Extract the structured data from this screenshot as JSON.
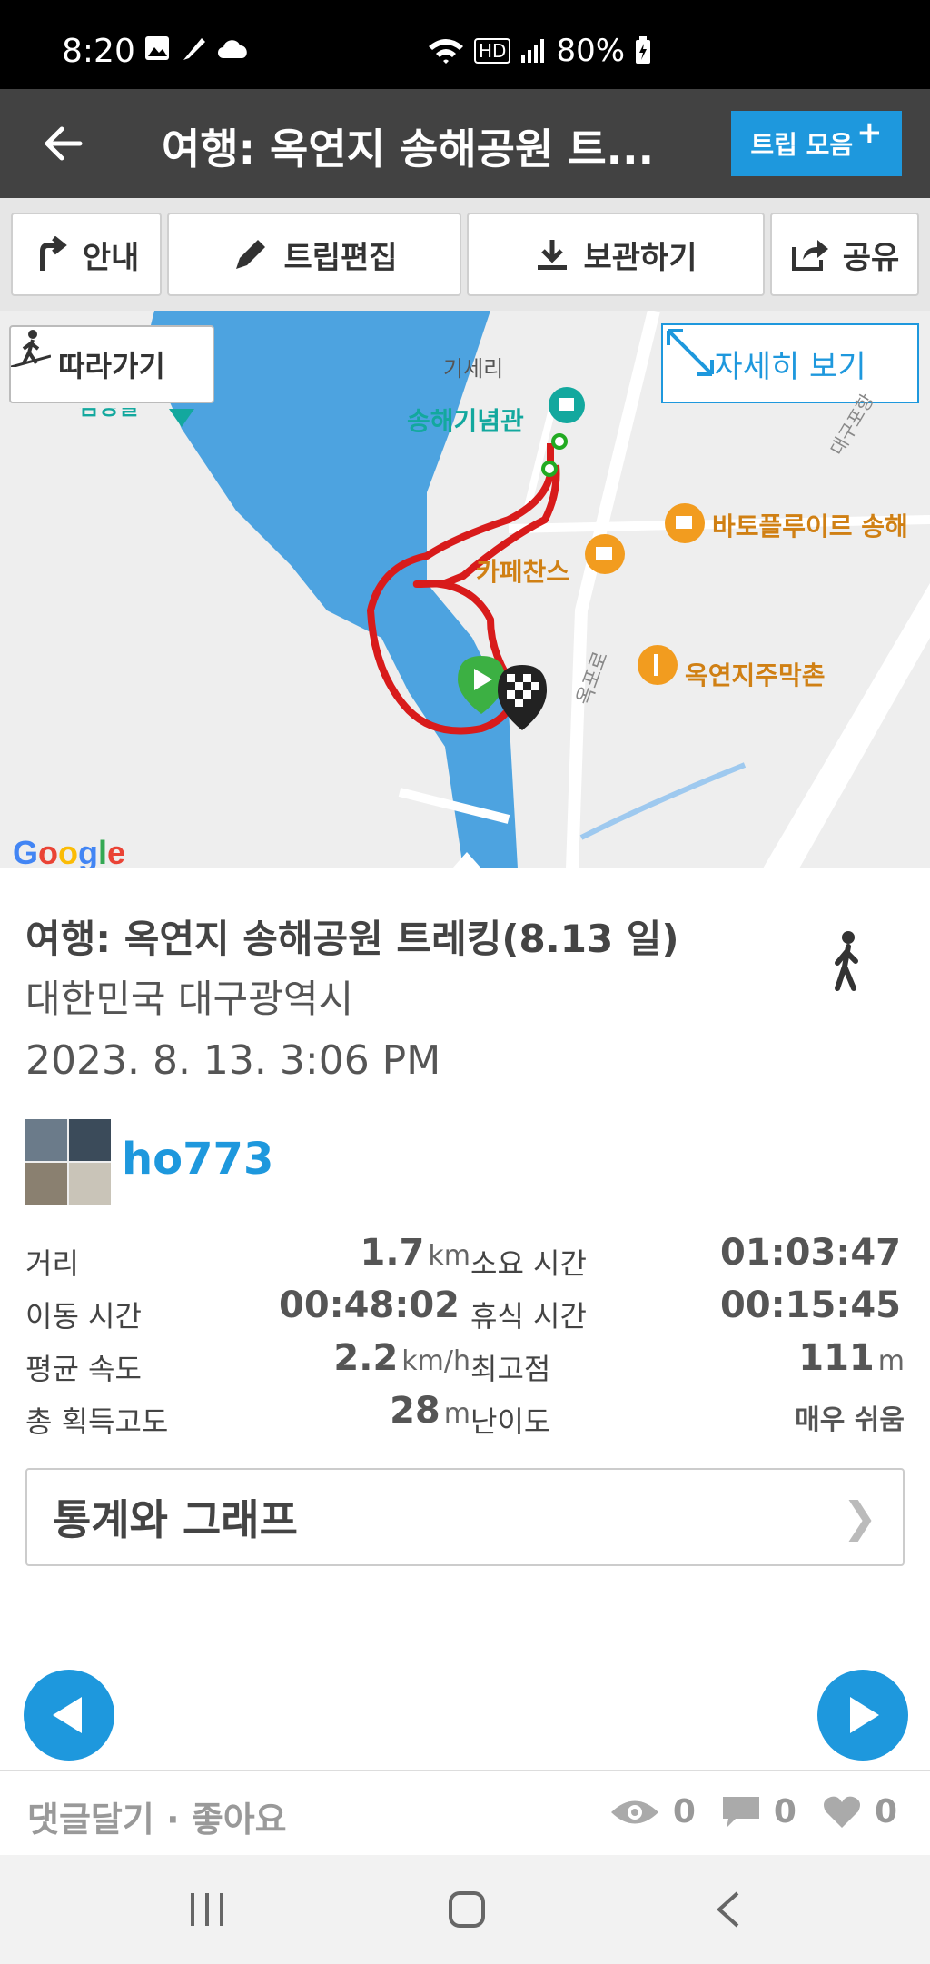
{
  "status": {
    "time": "8:20",
    "battery": "80%"
  },
  "header": {
    "title": "여행: 옥연지 송해공원 트...",
    "trip_button": "트립 모음"
  },
  "toolbar": {
    "guide": "안내",
    "edit": "트립편집",
    "save": "보관하기",
    "share": "공유"
  },
  "map": {
    "follow_button": "따라가기",
    "detail_button": "자세히 보기",
    "labels": {
      "area": "기세리",
      "memorial": "송해기념관",
      "cafe1": "바토플루이르 송해",
      "cafe2": "카페찬스",
      "restaurant": "옥연지주막촌",
      "road": "옥포로",
      "highway": "대구포항",
      "left_partial": "김영실"
    },
    "attribution": "Google"
  },
  "trip": {
    "title": "여행: 옥연지 송해공원 트레킹(8.13 일)",
    "location": "대한민국 대구광역시",
    "datetime": "2023. 8. 13. 3:06 PM",
    "activity_icon": "walking-icon",
    "username": "ho773"
  },
  "stats": {
    "distance_label": "거리",
    "distance_value": "1.7",
    "distance_unit": "km",
    "duration_label": "소요 시간",
    "duration_value": "01:03:47",
    "moving_label": "이동 시간",
    "moving_value": "00:48:02",
    "rest_label": "휴식 시간",
    "rest_value": "00:15:45",
    "speed_label": "평균 속도",
    "speed_value": "2.2",
    "speed_unit": "km/h",
    "max_alt_label": "최고점",
    "max_alt_value": "111",
    "max_alt_unit": "m",
    "gain_label": "총 획득고도",
    "gain_value": "28",
    "gain_unit": "m",
    "difficulty_label": "난이도",
    "difficulty_value": "매우 쉬움"
  },
  "stats_graph_button": "통계와 그래프",
  "footer": {
    "comment_like": "댓글달기 · 좋아요",
    "views": "0",
    "comments": "0",
    "likes": "0"
  },
  "colors": {
    "accent": "#1e98dd",
    "route": "#d81b1b",
    "appbar": "#424242"
  }
}
